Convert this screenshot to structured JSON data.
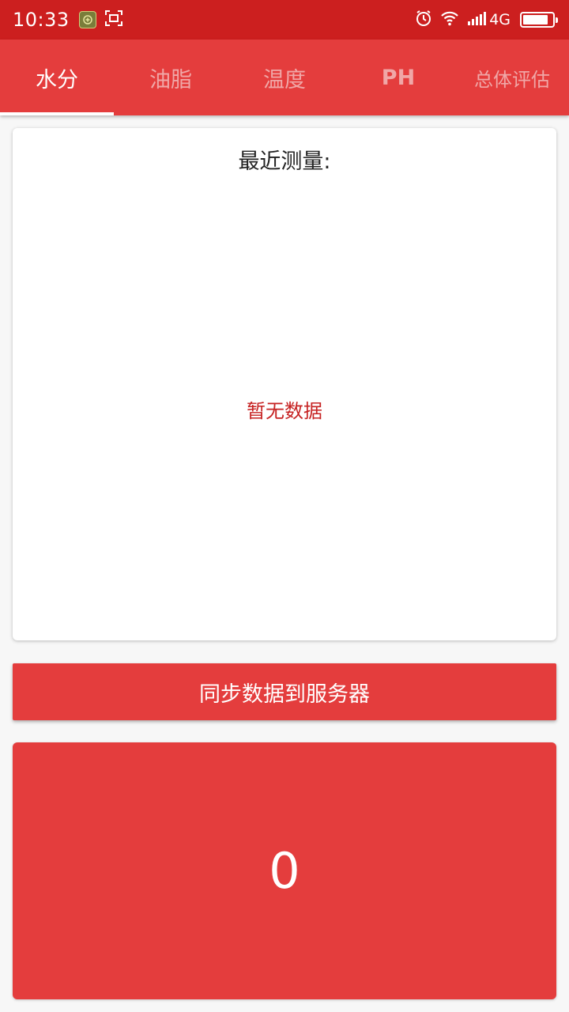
{
  "status_bar": {
    "time": "10:33",
    "network": "4G",
    "icons": [
      "shield-icon",
      "screenshot-icon",
      "alarm-icon",
      "wifi-icon",
      "signal-icon",
      "battery-icon"
    ]
  },
  "tabs": [
    {
      "label": "水分",
      "active": true
    },
    {
      "label": "油脂",
      "active": false
    },
    {
      "label": "温度",
      "active": false
    },
    {
      "label": "PH",
      "active": false
    },
    {
      "label": "总体评估",
      "active": false
    }
  ],
  "measurement_card": {
    "title": "最近测量:",
    "empty_text": "暂无数据"
  },
  "sync_button": {
    "label": "同步数据到服务器"
  },
  "value_panel": {
    "value": "0"
  },
  "colors": {
    "status_bar": "#cc1f1f",
    "accent": "#e43d3d",
    "empty_text": "#c62222"
  }
}
